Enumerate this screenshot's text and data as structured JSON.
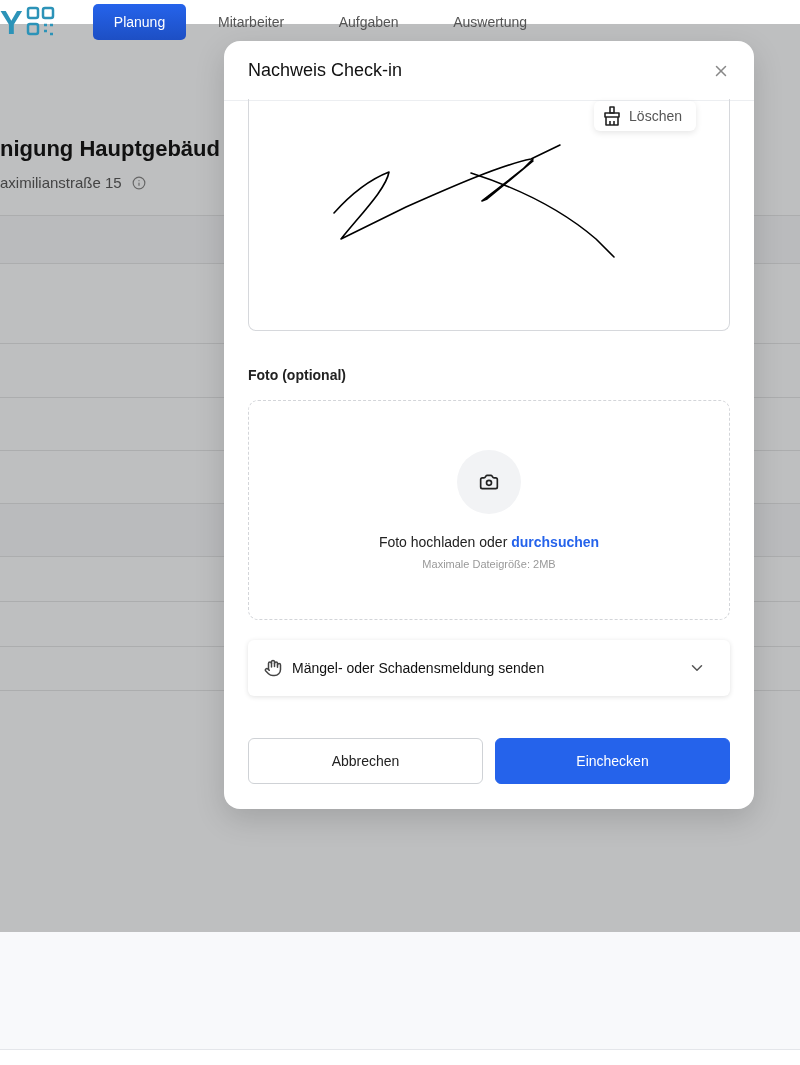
{
  "nav": {
    "logo_text": "Y",
    "tabs": [
      {
        "label": "Planung",
        "selected": true
      },
      {
        "label": "Mitarbeiter",
        "selected": false
      },
      {
        "label": "Aufgaben",
        "selected": false
      },
      {
        "label": "Auswertung",
        "selected": false
      }
    ]
  },
  "background_page": {
    "title": "nigung Hauptgebäud",
    "address": "aximilianstraße 15"
  },
  "dialog": {
    "title": "Nachweis Check-in",
    "signature": {
      "clear_button": "Löschen"
    },
    "photo": {
      "label": "Foto (optional)",
      "prompt": "Foto hochladen oder",
      "browse_link": "durchsuchen",
      "hint": "Maximale Dateigröße: 2MB"
    },
    "report": {
      "label": "Mängel- oder Schadensmeldung senden",
      "expanded": false
    },
    "buttons": {
      "cancel": "Abbrechen",
      "submit": "Einchecken"
    }
  }
}
